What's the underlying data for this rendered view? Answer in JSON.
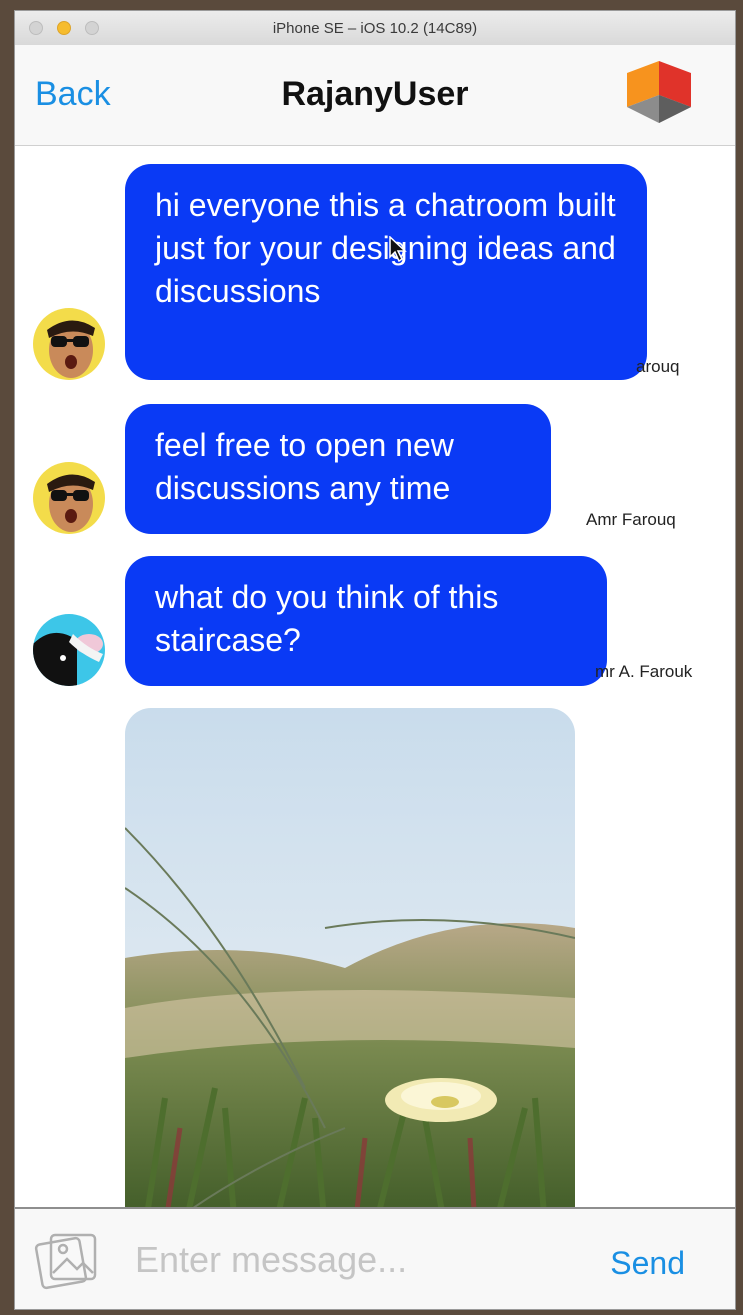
{
  "window": {
    "title": "iPhone SE – iOS 10.2 (14C89)"
  },
  "navbar": {
    "back_label": "Back",
    "title": "RajanyUser",
    "logo_icon": "cube-logo-icon"
  },
  "messages": [
    {
      "text": "hi everyone this a chatroom built just for your designing ideas and discussions",
      "sender": "arouq"
    },
    {
      "text": "feel free to open new discussions any time",
      "sender": "Amr Farouq"
    },
    {
      "text": "what do you think of this staircase?",
      "sender": "mr A. Farouk"
    }
  ],
  "input": {
    "placeholder": "Enter message...",
    "value": "",
    "send_label": "Send",
    "attach_icon": "photo-attach-icon"
  },
  "colors": {
    "bubble": "#0a3af5",
    "accent": "#1a8fe3"
  }
}
